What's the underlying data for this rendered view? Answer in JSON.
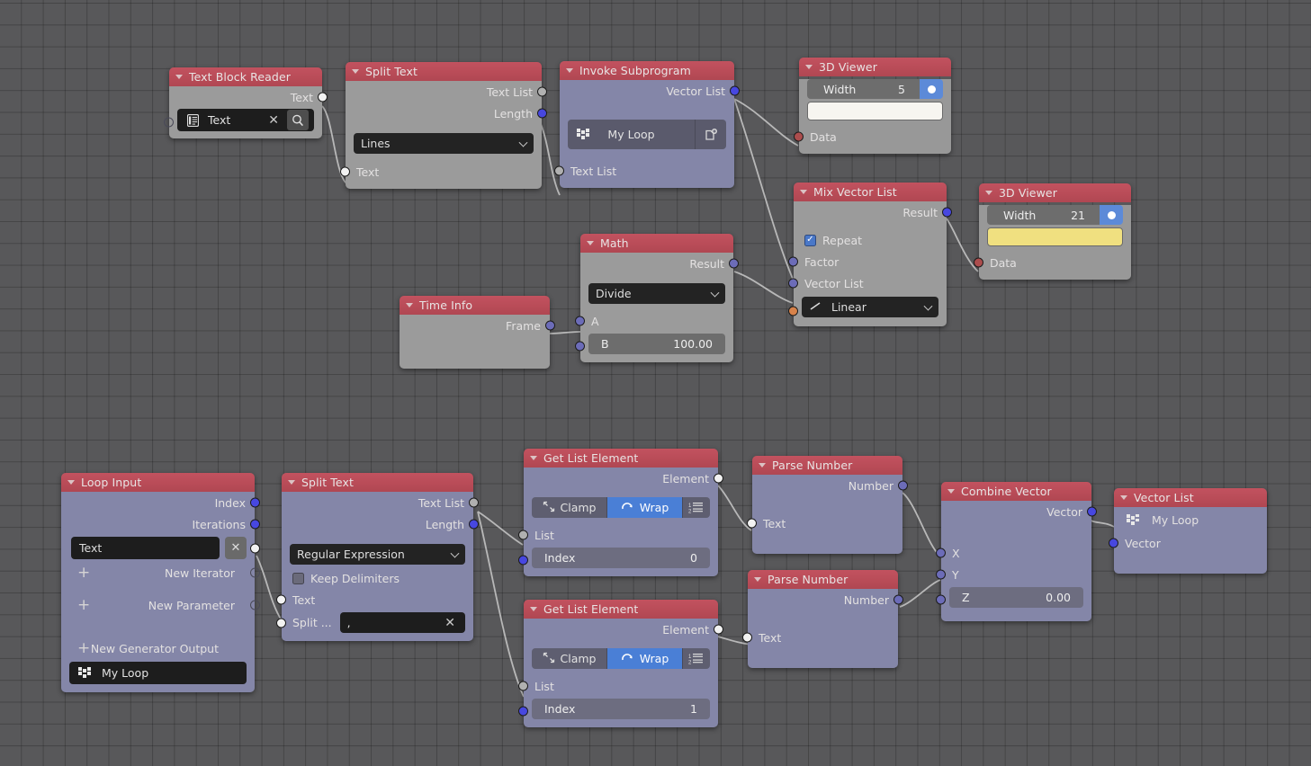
{
  "app": {
    "editor": "Blender Animation Nodes node editor",
    "background": "#58585a"
  },
  "colors": {
    "header": "#b94c58",
    "body_gray": "#9b9b9b",
    "body_purple": "#8486a8",
    "socket_blue": "#4747e0",
    "socket_violet": "#6c6cb8",
    "socket_white": "#f2f2f2",
    "socket_gray": "#b0b0b0",
    "socket_red": "#ac4d4d",
    "socket_orange": "#d7824a",
    "toggle_active": "#4a7fd6",
    "viewer_yellow": "#f0e080"
  },
  "nodes": [
    {
      "id": "text-block-reader",
      "title": "Text Block Reader",
      "outputs": [
        {
          "label": "Text"
        }
      ],
      "field": {
        "value": "Text",
        "clear": "✕",
        "icon": "text-block-icon",
        "search": "search-icon"
      }
    },
    {
      "id": "split-text-1",
      "title": "Split Text",
      "outputs": [
        {
          "label": "Text List"
        },
        {
          "label": "Length"
        }
      ],
      "select": {
        "value": "Lines"
      },
      "inputs": [
        {
          "label": "Text"
        }
      ]
    },
    {
      "id": "invoke-subprogram",
      "title": "Invoke Subprogram",
      "outputs": [
        {
          "label": "Vector List"
        }
      ],
      "subprogram": {
        "value": "My Loop",
        "icon": "subprogram-icon",
        "new_icon": "new-file-icon"
      },
      "inputs": [
        {
          "label": "Text List"
        }
      ]
    },
    {
      "id": "viewer-1",
      "title": "3D Viewer",
      "width": {
        "label": "Width",
        "value": "5"
      },
      "bar_color": "white",
      "inputs": [
        {
          "label": "Data"
        }
      ]
    },
    {
      "id": "viewer-2",
      "title": "3D Viewer",
      "width": {
        "label": "Width",
        "value": "21"
      },
      "bar_color": "yellow",
      "inputs": [
        {
          "label": "Data"
        }
      ]
    },
    {
      "id": "mix-vector-list",
      "title": "Mix Vector List",
      "outputs": [
        {
          "label": "Result"
        }
      ],
      "checkbox": {
        "label": "Repeat",
        "checked": true
      },
      "inputs": [
        {
          "label": "Factor"
        },
        {
          "label": "Vector List"
        }
      ],
      "select": {
        "value": "Linear",
        "icon": "interpolation-icon"
      }
    },
    {
      "id": "math",
      "title": "Math",
      "outputs": [
        {
          "label": "Result"
        }
      ],
      "select": {
        "value": "Divide"
      },
      "inputs": [
        {
          "label": "A"
        }
      ],
      "number": {
        "label": "B",
        "value": "100.00"
      }
    },
    {
      "id": "time-info",
      "title": "Time Info",
      "outputs": [
        {
          "label": "Frame"
        }
      ]
    },
    {
      "id": "loop-input",
      "title": "Loop Input",
      "outputs": [
        {
          "label": "Index"
        },
        {
          "label": "Iterations"
        }
      ],
      "field": {
        "value": "Text",
        "clear": "✕"
      },
      "adders": [
        {
          "label": "New Iterator",
          "plus": "+"
        },
        {
          "label": "New Parameter",
          "plus": "+"
        },
        {
          "label": "New Generator Output",
          "plus": "+"
        }
      ],
      "loop_button": {
        "value": "My Loop",
        "icon": "subprogram-icon"
      }
    },
    {
      "id": "split-text-2",
      "title": "Split Text",
      "outputs": [
        {
          "label": "Text List"
        },
        {
          "label": "Length"
        }
      ],
      "select": {
        "value": "Regular Expression"
      },
      "checkbox": {
        "label": "Keep Delimiters",
        "checked": false
      },
      "inputs": [
        {
          "label": "Text"
        }
      ],
      "split_field": {
        "label": "Split ...",
        "value": ",",
        "clear": "✕"
      }
    },
    {
      "id": "get-list-element-1",
      "title": "Get List Element",
      "outputs": [
        {
          "label": "Element"
        }
      ],
      "toggles": [
        {
          "label": "Clamp",
          "active": false,
          "icon": "clamp-icon"
        },
        {
          "label": "Wrap",
          "active": true,
          "icon": "wrap-icon"
        },
        {
          "label": "",
          "active": false,
          "icon": "list-order-icon"
        }
      ],
      "inputs": [
        {
          "label": "List"
        }
      ],
      "number": {
        "label": "Index",
        "value": "0"
      }
    },
    {
      "id": "get-list-element-2",
      "title": "Get List Element",
      "outputs": [
        {
          "label": "Element"
        }
      ],
      "toggles": [
        {
          "label": "Clamp",
          "active": false,
          "icon": "clamp-icon"
        },
        {
          "label": "Wrap",
          "active": true,
          "icon": "wrap-icon"
        },
        {
          "label": "",
          "active": false,
          "icon": "list-order-icon"
        }
      ],
      "inputs": [
        {
          "label": "List"
        }
      ],
      "number": {
        "label": "Index",
        "value": "1"
      }
    },
    {
      "id": "parse-number-1",
      "title": "Parse Number",
      "outputs": [
        {
          "label": "Number"
        }
      ],
      "inputs": [
        {
          "label": "Text"
        }
      ]
    },
    {
      "id": "parse-number-2",
      "title": "Parse Number",
      "outputs": [
        {
          "label": "Number"
        }
      ],
      "inputs": [
        {
          "label": "Text"
        }
      ]
    },
    {
      "id": "combine-vector",
      "title": "Combine Vector",
      "outputs": [
        {
          "label": "Vector"
        }
      ],
      "inputs": [
        {
          "label": "X"
        },
        {
          "label": "Y"
        }
      ],
      "number": {
        "label": "Z",
        "value": "0.00"
      }
    },
    {
      "id": "vector-list-output",
      "title": "Vector List",
      "loop_label": {
        "value": "My Loop",
        "icon": "subprogram-icon"
      },
      "inputs": [
        {
          "label": "Vector"
        }
      ]
    }
  ]
}
